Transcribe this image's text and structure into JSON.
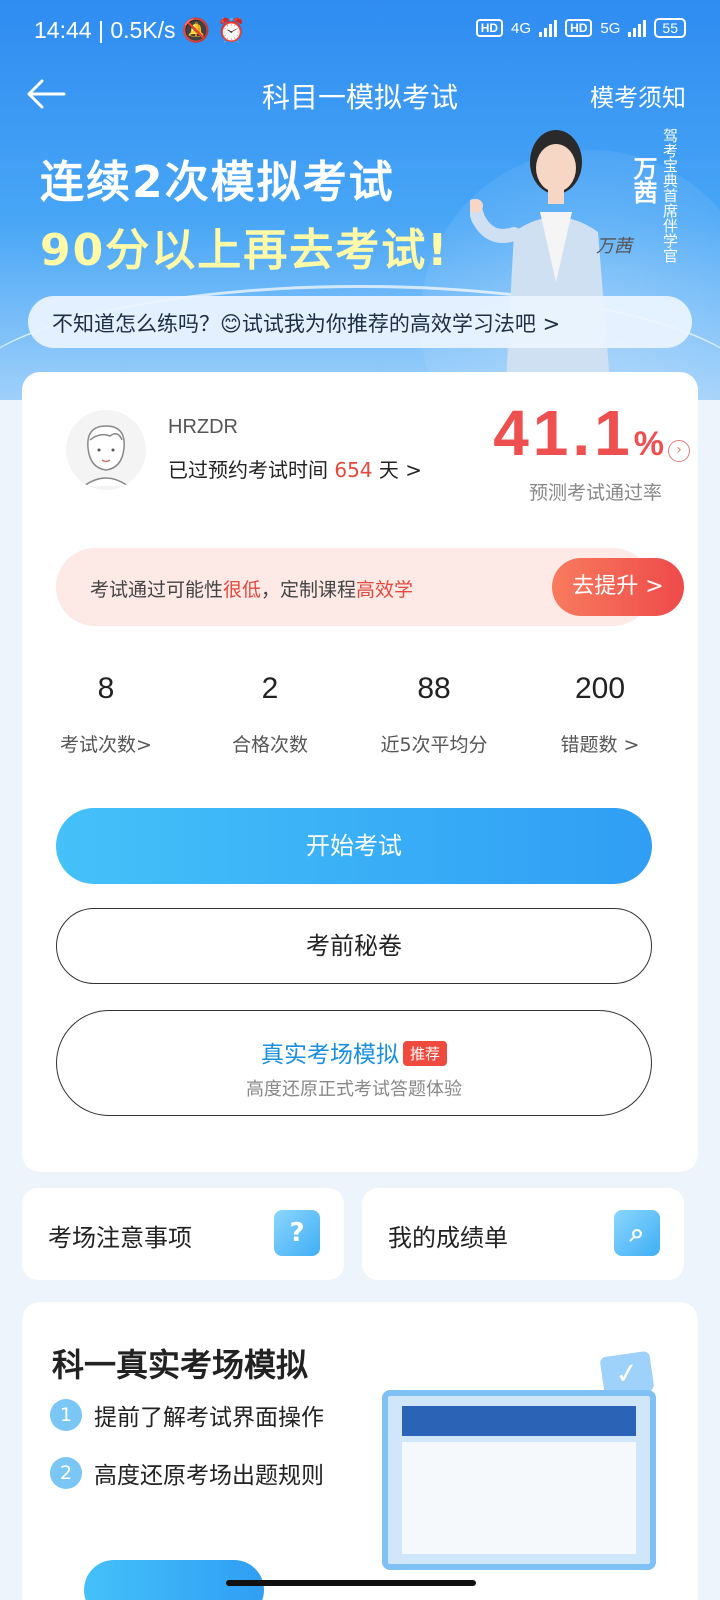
{
  "status": {
    "time": "14:44",
    "net_speed": "0.5K/s",
    "sim1": "4G",
    "sim2": "5G",
    "hd": "HD",
    "battery": "55"
  },
  "nav": {
    "title": "科目一模拟考试",
    "right": "模考须知"
  },
  "banner": {
    "line1": "连续2次模拟考试",
    "line2": "90分以上再去考试!",
    "coach_name": "万茜",
    "coach_title": "驾考宝典首席伴学官",
    "signature": "万茜"
  },
  "tip_bar": "不知道怎么练吗？😊试试我为你推荐的高效学习法吧 >",
  "user": {
    "name": "HRZDR",
    "reserve_prefix": "已过预约考试时间",
    "reserve_days": "654",
    "reserve_suffix": "天 >"
  },
  "pass_rate": {
    "value": "41.1",
    "unit": "%",
    "label": "预测考试通过率"
  },
  "pass_tip": {
    "part1": "考试通过可能性",
    "part2": "很低",
    "part3": "，定制课程",
    "part4": "高效学",
    "button": "去提升 >"
  },
  "stats": [
    {
      "value": "8",
      "label": "考试次数>"
    },
    {
      "value": "2",
      "label": "合格次数"
    },
    {
      "value": "88",
      "label": "近5次平均分"
    },
    {
      "value": "200",
      "label": "错题数 >"
    }
  ],
  "buttons": {
    "start": "开始考试",
    "secret": "考前秘卷",
    "real_title": "真实考场模拟",
    "real_badge": "推荐",
    "real_sub": "高度还原正式考试答题体验"
  },
  "mini_cards": [
    {
      "title": "考场注意事项",
      "icon": "question-icon"
    },
    {
      "title": "我的成绩单",
      "icon": "search-doc-icon"
    }
  ],
  "bottom": {
    "title": "科一真实考场模拟",
    "items": [
      {
        "num": "1",
        "text": "提前了解考试界面操作"
      },
      {
        "num": "2",
        "text": "高度还原考场出题规则"
      }
    ]
  }
}
